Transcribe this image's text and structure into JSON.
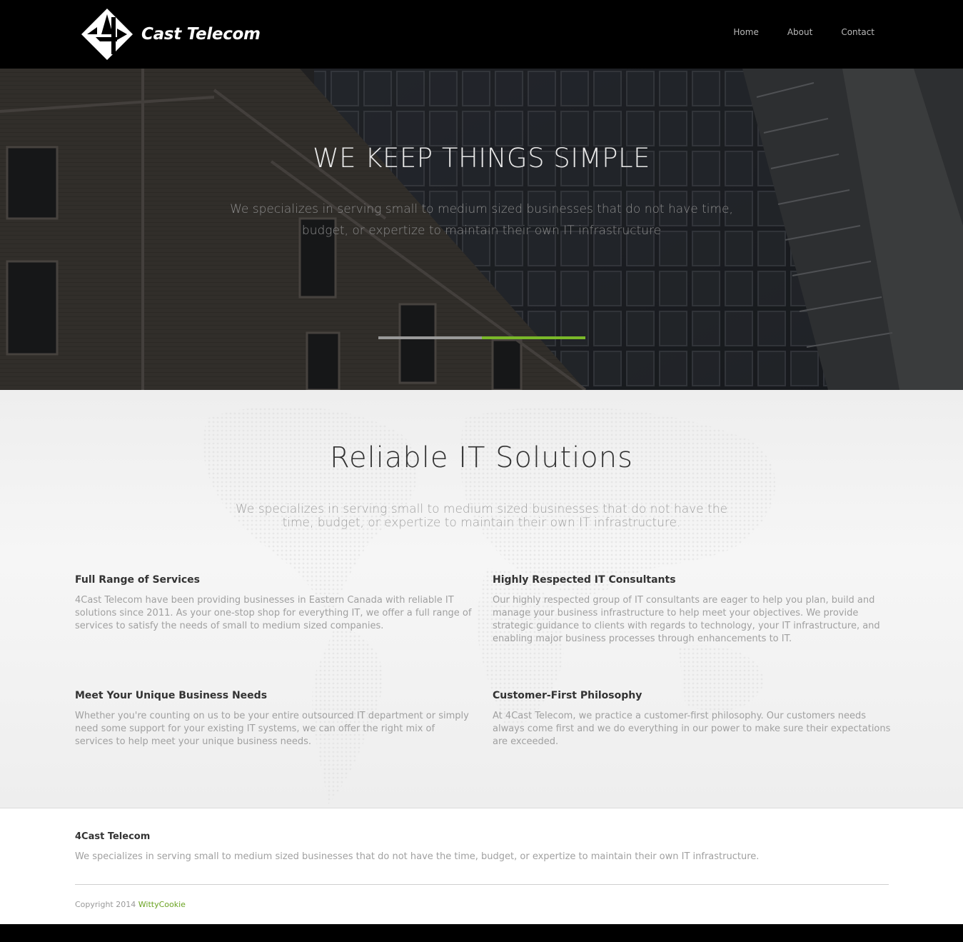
{
  "header": {
    "brand": "Cast Telecom",
    "logo_icon": "4-arrow-logo-icon",
    "nav": [
      {
        "label": "Home"
      },
      {
        "label": "About"
      },
      {
        "label": "Contact"
      }
    ]
  },
  "hero": {
    "title": "WE KEEP THINGS SIMPLE",
    "subtitle": "We specializes in serving small to medium sized businesses that do not have time, budget, or expertize to maintain their own IT infrastructure",
    "slides_total": 2,
    "active_slide": 2,
    "accent_color": "#7ab829"
  },
  "main": {
    "title": "Reliable IT Solutions",
    "subtitle": "We specializes in serving small to medium sized businesses that do not have the time, budget, or expertize to maintain their own IT infrastructure.",
    "features": [
      {
        "title": "Full Range of Services",
        "text": "4Cast Telecom have been providing businesses in Eastern Canada with reliable IT solutions since 2011. As your one-stop shop for everything IT, we offer a full range of services to satisfy the needs of small to medium sized companies."
      },
      {
        "title": "Highly Respected IT Consultants",
        "text": "Our highly respected group of IT consultants are eager to help you plan, build and manage your business infrastructure to help meet your objectives. We provide strategic guidance to clients with regards to technology, your IT infrastructure, and enabling major business processes through enhancements to IT."
      },
      {
        "title": "Meet Your Unique Business Needs",
        "text": "Whether you're counting on us to be your entire outsourced IT department or simply need some support for your existing IT systems, we can offer the right mix of services to help meet your unique business needs."
      },
      {
        "title": "Customer-First Philosophy",
        "text": "At 4Cast Telecom, we practice a customer-first philosophy. Our customers needs always come first and we do everything in our power to make sure their expectations are exceeded."
      }
    ]
  },
  "footer": {
    "title": "4Cast Telecom",
    "description": "We specializes in serving small to medium sized businesses that do not have the time, budget, or expertize to maintain their own IT infrastructure.",
    "copyright_prefix": "Copyright 2014",
    "copyright_link": "WittyCookie",
    "link_color": "#6aa321"
  }
}
